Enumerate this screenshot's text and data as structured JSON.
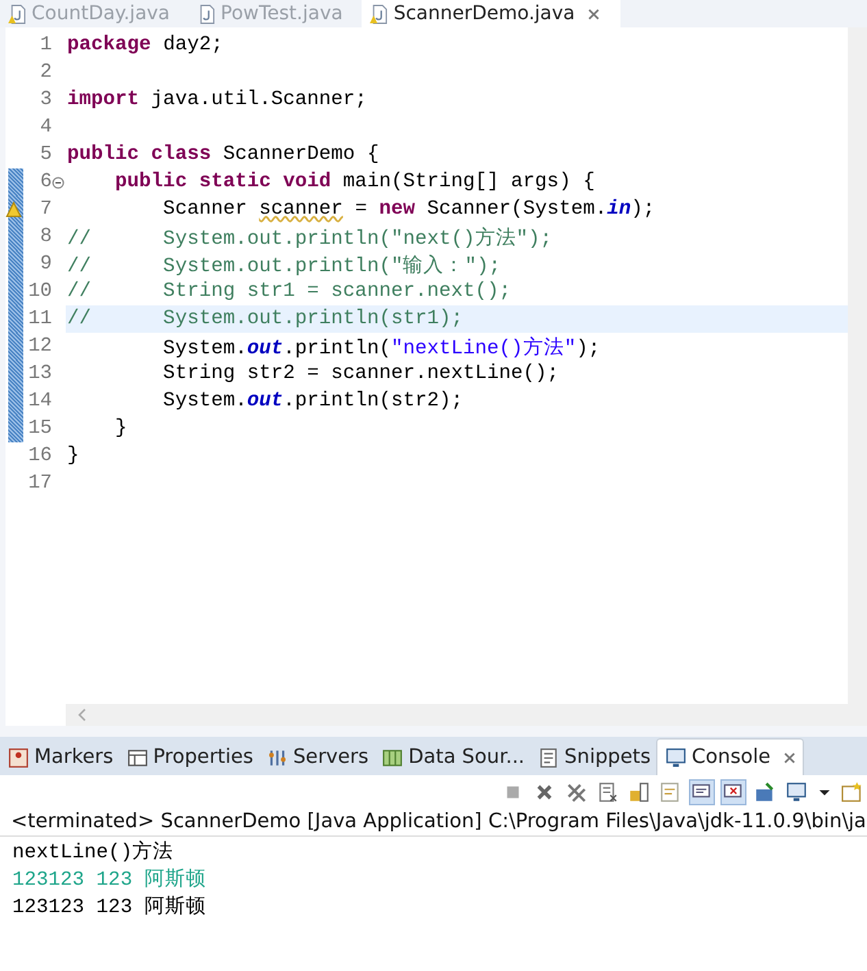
{
  "editor_tabs": [
    {
      "label": "CountDay.java",
      "selected": false,
      "warning": true,
      "closable": false
    },
    {
      "label": "PowTest.java",
      "selected": false,
      "warning": false,
      "closable": false
    },
    {
      "label": "ScannerDemo.java",
      "selected": true,
      "warning": true,
      "closable": true
    }
  ],
  "code_lines": [
    {
      "number": "1",
      "changed": false,
      "current": false,
      "fold": false,
      "warning": false,
      "tokens": [
        {
          "kind": "keyword",
          "text": "package"
        },
        {
          "kind": "plain",
          "text": " day2;"
        }
      ]
    },
    {
      "number": "2",
      "changed": false,
      "current": false,
      "fold": false,
      "warning": false
    },
    {
      "number": "3",
      "changed": false,
      "current": false,
      "fold": false,
      "warning": false,
      "tokens": [
        {
          "kind": "keyword",
          "text": "import"
        },
        {
          "kind": "plain",
          "text": " java.util.Scanner;"
        }
      ]
    },
    {
      "number": "4",
      "changed": false,
      "current": false,
      "fold": false,
      "warning": false
    },
    {
      "number": "5",
      "changed": false,
      "current": false,
      "fold": false,
      "warning": false,
      "tokens": [
        {
          "kind": "keyword",
          "text": "public class"
        },
        {
          "kind": "plain",
          "text": " ScannerDemo {"
        }
      ]
    },
    {
      "number": "6",
      "changed": true,
      "current": false,
      "fold": true,
      "warning": false,
      "tokens": [
        {
          "kind": "keyword",
          "text": "    public static void"
        },
        {
          "kind": "plain",
          "text": " main(String[] args) {"
        }
      ]
    },
    {
      "number": "7",
      "changed": true,
      "current": false,
      "fold": false,
      "warning": true,
      "tokens": [
        {
          "kind": "plain",
          "text": "        Scanner "
        },
        {
          "kind": "warned",
          "text": "scanner"
        },
        {
          "kind": "plain",
          "text": " = "
        },
        {
          "kind": "keyword",
          "text": "new"
        },
        {
          "kind": "plain",
          "text": " Scanner(System."
        },
        {
          "kind": "field",
          "text": "in"
        },
        {
          "kind": "plain",
          "text": ");"
        }
      ]
    },
    {
      "number": "8",
      "changed": true,
      "current": false,
      "fold": false,
      "warning": false,
      "tokens": [
        {
          "kind": "comment",
          "text": "//      System.out.println(\"next()方法\");"
        }
      ]
    },
    {
      "number": "9",
      "changed": true,
      "current": false,
      "fold": false,
      "warning": false,
      "tokens": [
        {
          "kind": "comment",
          "text": "//      System.out.println(\"输入：\");"
        }
      ]
    },
    {
      "number": "10",
      "changed": true,
      "current": false,
      "fold": false,
      "warning": false,
      "tokens": [
        {
          "kind": "comment",
          "text": "//      String str1 = scanner.next();"
        }
      ]
    },
    {
      "number": "11",
      "changed": true,
      "current": true,
      "fold": false,
      "warning": false,
      "tokens": [
        {
          "kind": "comment",
          "text": "//      System.out.println(str1);"
        }
      ]
    },
    {
      "number": "12",
      "changed": true,
      "current": false,
      "fold": false,
      "warning": false,
      "tokens": [
        {
          "kind": "plain",
          "text": "        System."
        },
        {
          "kind": "field",
          "text": "out"
        },
        {
          "kind": "plain",
          "text": ".println("
        },
        {
          "kind": "string",
          "text": "\"nextLine()方法\""
        },
        {
          "kind": "plain",
          "text": ");"
        }
      ]
    },
    {
      "number": "13",
      "changed": true,
      "current": false,
      "fold": false,
      "warning": false,
      "tokens": [
        {
          "kind": "plain",
          "text": "        String str2 = scanner.nextLine();"
        }
      ]
    },
    {
      "number": "14",
      "changed": true,
      "current": false,
      "fold": false,
      "warning": false,
      "tokens": [
        {
          "kind": "plain",
          "text": "        System."
        },
        {
          "kind": "field",
          "text": "out"
        },
        {
          "kind": "plain",
          "text": ".println(str2);"
        }
      ]
    },
    {
      "number": "15",
      "changed": true,
      "current": false,
      "fold": false,
      "warning": false,
      "tokens": [
        {
          "kind": "plain",
          "text": "    }"
        }
      ]
    },
    {
      "number": "16",
      "changed": false,
      "current": false,
      "fold": false,
      "warning": false,
      "tokens": [
        {
          "kind": "plain",
          "text": "}"
        }
      ]
    },
    {
      "number": "17",
      "changed": false,
      "current": false,
      "fold": false,
      "warning": false
    }
  ],
  "panel_tabs": [
    {
      "label": "Markers",
      "selected": false
    },
    {
      "label": "Properties",
      "selected": false
    },
    {
      "label": "Servers",
      "selected": false
    },
    {
      "label": "Data Sour...",
      "selected": false
    },
    {
      "label": "Snippets",
      "selected": false
    },
    {
      "label": "Console",
      "selected": true
    }
  ],
  "console": {
    "header": "<terminated> ScannerDemo [Java Application] C:\\Program Files\\Java\\jdk-11.0.9\\bin\\ja",
    "lines": [
      {
        "kind": "output",
        "text": "nextLine()方法"
      },
      {
        "kind": "input",
        "text": "123123 123 阿斯顿"
      },
      {
        "kind": "output",
        "text": "123123 123 阿斯顿"
      }
    ]
  }
}
